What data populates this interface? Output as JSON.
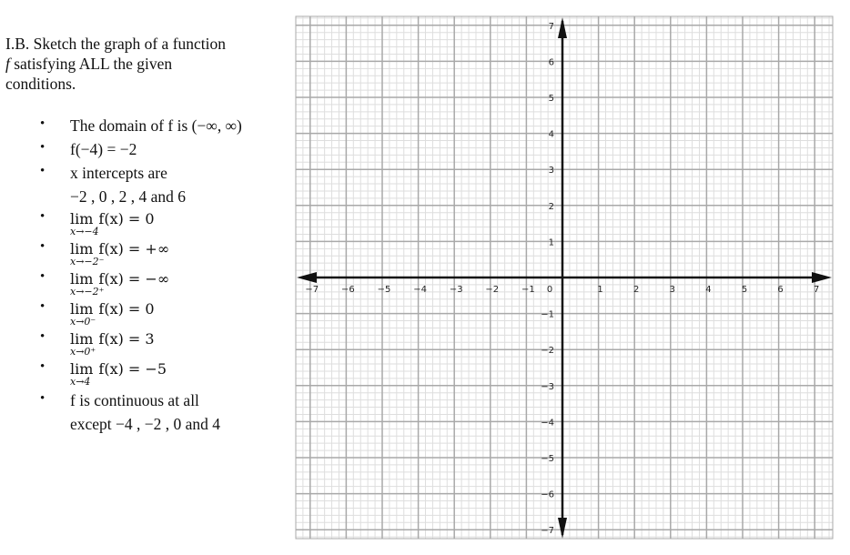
{
  "problem": {
    "heading_prefix": "I.B. Sketch the graph of a function",
    "heading_fn": "f",
    "heading_line2": " satisfying ALL the given",
    "heading_line3": "conditions.",
    "conditions": [
      {
        "type": "text",
        "text": "The domain of f is (−∞, ∞)"
      },
      {
        "type": "text",
        "text": "f(−4) = −2"
      },
      {
        "type": "text",
        "text": "x intercepts are"
      },
      {
        "type": "text-cont",
        "text": "−2 , 0 , 2 , 4 and 6"
      },
      {
        "type": "limit",
        "lim": "lim",
        "sub": "x→−4",
        "expr": "f(x) = 0"
      },
      {
        "type": "limit",
        "lim": "lim",
        "sub": "x→−2⁻",
        "expr": "f(x) = +∞"
      },
      {
        "type": "limit",
        "lim": "lim",
        "sub": "x→−2⁺",
        "expr": "f(x) = −∞"
      },
      {
        "type": "limit",
        "lim": "lim",
        "sub": "x→0⁻",
        "expr": "f(x) = 0"
      },
      {
        "type": "limit",
        "lim": "lim",
        "sub": "x→0⁺",
        "expr": "f(x) = 3"
      },
      {
        "type": "limit",
        "lim": "lim",
        "sub": "x→4",
        "expr": "f(x) = −5"
      },
      {
        "type": "text",
        "text": "f is continuous at all"
      },
      {
        "type": "text-cont",
        "text": "except −4 , −2 , 0  and 4"
      }
    ],
    "bullet": "•"
  },
  "chart_data": {
    "type": "grid",
    "title": "",
    "xlabel": "",
    "ylabel": "",
    "xlim": [
      -7,
      7
    ],
    "ylim": [
      -7,
      7
    ],
    "minor_divisions_per_unit": 5,
    "grid": true,
    "x_tick_labels": [
      "-7",
      "-6",
      "-5",
      "-4",
      "-3",
      "-2",
      "-1",
      "0",
      "1",
      "2",
      "3",
      "4",
      "5",
      "6",
      "7"
    ],
    "y_tick_labels": [
      "7",
      "6",
      "5",
      "4",
      "3",
      "2",
      "1",
      "-1",
      "-2",
      "-3",
      "-4",
      "-5",
      "-6",
      "-7"
    ],
    "axes_arrows": "both-ends",
    "series": []
  },
  "colors": {
    "major_grid": "#a9a9a9",
    "minor_grid": "#dedede",
    "axis": "#111111"
  }
}
